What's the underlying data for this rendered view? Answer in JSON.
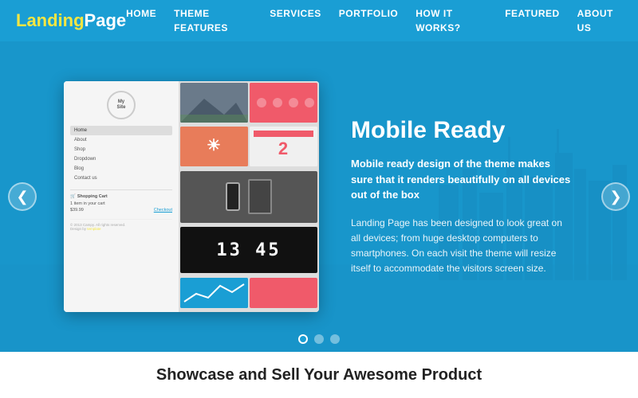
{
  "logo": {
    "landing": "Landing",
    "page": "Page"
  },
  "nav": {
    "items": [
      {
        "label": "HOME",
        "id": "home"
      },
      {
        "label": "THEME FEATURES",
        "id": "theme-features"
      },
      {
        "label": "SERVICES",
        "id": "services"
      },
      {
        "label": "PORTFOLIO",
        "id": "portfolio"
      },
      {
        "label": "HOW IT WORKS?",
        "id": "how-it-works"
      },
      {
        "label": "FEATURED",
        "id": "featured"
      },
      {
        "label": "ABOUT US",
        "id": "about-us"
      }
    ]
  },
  "hero": {
    "title": "Mobile Ready",
    "desc1": "Mobile ready design of the theme makes sure that it renders beautifully on all devices out of the box",
    "desc2": "Landing Page has been designed to look great on all devices; from huge desktop computers to smartphones. On each visit the theme will resize itself to accommodate the visitors screen size.",
    "arrow_left": "❮",
    "arrow_right": "❯"
  },
  "mockup": {
    "logo_text": "My\nSite",
    "nav_items": [
      "Home",
      "About",
      "Shop",
      "Dropdown",
      "Blog",
      "Contact us"
    ],
    "cart_label": "Shopping Cart",
    "cart_item": "1 item in your cart",
    "cart_price": "$39.99",
    "checkout": "Checkout",
    "copyright": "© 2013 Campy. All rights reserved.",
    "design_by": "Design by",
    "design_template": "template",
    "tile_number": "2",
    "clock_time": "13 45"
  },
  "dots": [
    {
      "active": true
    },
    {
      "active": false
    },
    {
      "active": false
    }
  ],
  "bottom": {
    "title": "Showcase and Sell Your Awesome Product"
  }
}
